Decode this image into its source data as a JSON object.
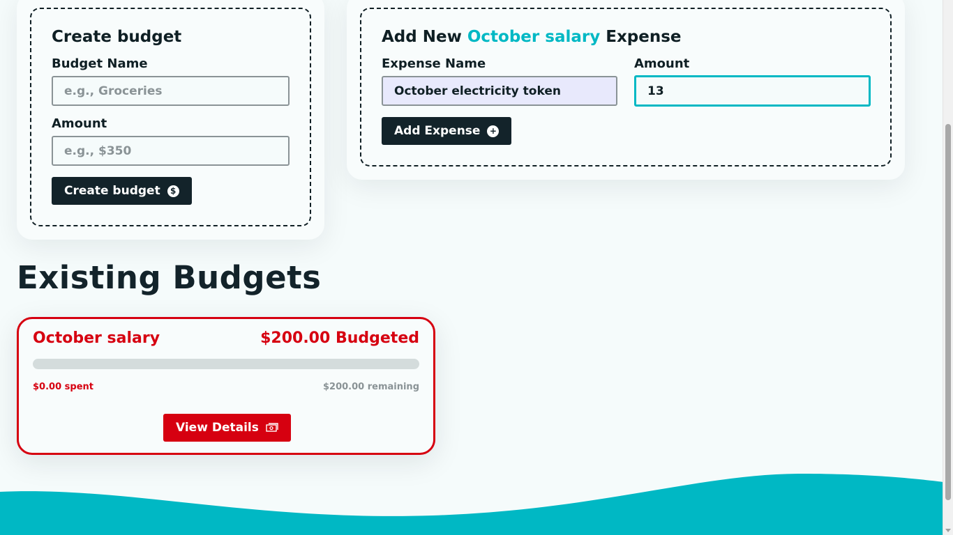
{
  "create_budget": {
    "title": "Create budget",
    "name_label": "Budget Name",
    "name_placeholder": "e.g., Groceries",
    "amount_label": "Amount",
    "amount_placeholder": "e.g., $350",
    "button_label": "Create budget",
    "button_icon": "dollar-circle-icon",
    "button_icon_glyph": "$"
  },
  "add_expense": {
    "title_prefix": "Add New",
    "budget_name": "October salary",
    "title_suffix": "Expense",
    "name_label": "Expense Name",
    "name_value": "October electricity token",
    "amount_label": "Amount",
    "amount_value": "13",
    "button_label": "Add Expense",
    "button_icon": "plus-circle-icon",
    "button_icon_glyph": "+"
  },
  "existing_budgets": {
    "heading": "Existing Budgets",
    "items": [
      {
        "name": "October salary",
        "budgeted": "$200.00 Budgeted",
        "spent": "$0.00 spent",
        "remaining": "$200.00 remaining",
        "progress_fraction": 0,
        "button_label": "View Details",
        "button_icon": "money-bill-icon"
      }
    ]
  },
  "colors": {
    "accent": "#00b8c4",
    "danger": "#d60010",
    "dark": "#13232a",
    "background": "#f5fbfb"
  }
}
